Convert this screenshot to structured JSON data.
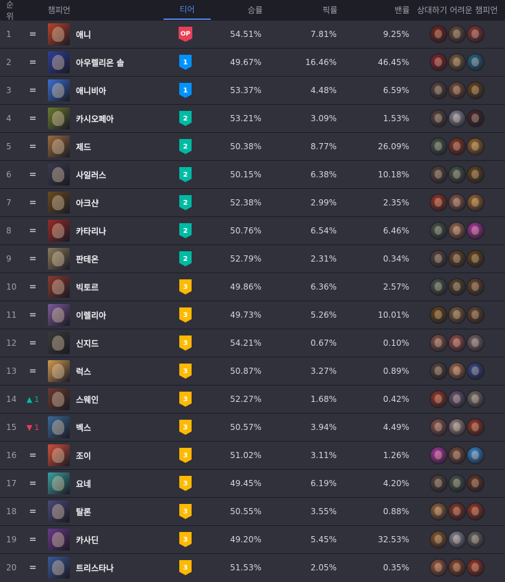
{
  "colors": {
    "op": "#e84057",
    "tier1": "#0093ff",
    "tier2": "#00bba3",
    "tier3": "#ffb900",
    "up": "#00bba3",
    "down": "#e84057",
    "active_tab": "#5383e8"
  },
  "header": {
    "rank": "순위",
    "champion": "챔피언",
    "tier": "티어",
    "winrate": "승률",
    "pickrate": "픽률",
    "banrate": "밴률",
    "counters": "상대하기 어려운 챔피언"
  },
  "rows": [
    {
      "rank": "1",
      "change": "=",
      "dir": "same",
      "name": "애니",
      "tier": "OP",
      "tierClass": "op",
      "win": "54.51%",
      "pick": "7.81%",
      "ban": "9.25%",
      "portrait": "#b8442a",
      "counters": [
        "#7a2a22",
        "#6a5140",
        "#8a3b3c"
      ]
    },
    {
      "rank": "2",
      "change": "=",
      "dir": "same",
      "name": "아우렐리온 솔",
      "tier": "1",
      "tierClass": "t1",
      "win": "49.67%",
      "pick": "16.46%",
      "ban": "46.45%",
      "portrait": "#2f3f9a",
      "counters": [
        "#8a2a30",
        "#7a6040",
        "#2a6a8a"
      ]
    },
    {
      "rank": "3",
      "change": "=",
      "dir": "same",
      "name": "애니비아",
      "tier": "1",
      "tierClass": "t1",
      "win": "53.37%",
      "pick": "4.48%",
      "ban": "6.59%",
      "portrait": "#3a6fd0",
      "counters": [
        "#5a4a44",
        "#7a5040",
        "#6a4a20"
      ]
    },
    {
      "rank": "4",
      "change": "=",
      "dir": "same",
      "name": "카시오페아",
      "tier": "2",
      "tierClass": "t2",
      "win": "53.21%",
      "pick": "3.09%",
      "ban": "1.53%",
      "portrait": "#6a7a30",
      "counters": [
        "#5a4a44",
        "#8a8a9a",
        "#4a2a30"
      ]
    },
    {
      "rank": "5",
      "change": "=",
      "dir": "same",
      "name": "제드",
      "tier": "2",
      "tierClass": "t2",
      "win": "50.38%",
      "pick": "8.77%",
      "ban": "26.09%",
      "portrait": "#9a6a40",
      "counters": [
        "#4a5a50",
        "#8a3a2a",
        "#9a6a30"
      ]
    },
    {
      "rank": "6",
      "change": "=",
      "dir": "same",
      "name": "사일러스",
      "tier": "2",
      "tierClass": "t2",
      "win": "50.15%",
      "pick": "6.38%",
      "ban": "10.18%",
      "portrait": "#3a3a50",
      "counters": [
        "#5a4a44",
        "#4a5a50",
        "#6a4a20"
      ]
    },
    {
      "rank": "7",
      "change": "=",
      "dir": "same",
      "name": "아크샨",
      "tier": "2",
      "tierClass": "t2",
      "win": "52.38%",
      "pick": "2.99%",
      "ban": "2.35%",
      "portrait": "#6a4a20",
      "counters": [
        "#9a3a2a",
        "#8a5a50",
        "#9a6a30"
      ]
    },
    {
      "rank": "8",
      "change": "=",
      "dir": "same",
      "name": "카타리나",
      "tier": "2",
      "tierClass": "t2",
      "win": "50.76%",
      "pick": "6.54%",
      "ban": "6.46%",
      "portrait": "#9a2a2a",
      "counters": [
        "#4a5a50",
        "#9a6a50",
        "#b03aa0"
      ]
    },
    {
      "rank": "9",
      "change": "=",
      "dir": "same",
      "name": "판테온",
      "tier": "2",
      "tierClass": "t2",
      "win": "52.79%",
      "pick": "2.31%",
      "ban": "0.34%",
      "portrait": "#8a7a5a",
      "counters": [
        "#5a4a44",
        "#6a4a30",
        "#6a4a20"
      ]
    },
    {
      "rank": "10",
      "change": "=",
      "dir": "same",
      "name": "빅토르",
      "tier": "3",
      "tierClass": "t3",
      "win": "49.86%",
      "pick": "6.36%",
      "ban": "2.57%",
      "portrait": "#8a3a30",
      "counters": [
        "#4a5a50",
        "#5a4a30",
        "#6a4a30"
      ]
    },
    {
      "rank": "11",
      "change": "=",
      "dir": "same",
      "name": "이렐리아",
      "tier": "3",
      "tierClass": "t3",
      "win": "49.73%",
      "pick": "5.26%",
      "ban": "10.01%",
      "portrait": "#7a5a9a",
      "counters": [
        "#6a4a20",
        "#7a6040",
        "#6a4a30"
      ]
    },
    {
      "rank": "12",
      "change": "=",
      "dir": "same",
      "name": "신지드",
      "tier": "3",
      "tierClass": "t3",
      "win": "54.21%",
      "pick": "0.67%",
      "ban": "0.10%",
      "portrait": "#3a3a3a",
      "counters": [
        "#8a5a50",
        "#9a5050",
        "#7a6a70"
      ]
    },
    {
      "rank": "13",
      "change": "=",
      "dir": "same",
      "name": "럭스",
      "tier": "3",
      "tierClass": "t3",
      "win": "50.87%",
      "pick": "3.27%",
      "ban": "0.89%",
      "portrait": "#d09a50",
      "counters": [
        "#5a4a44",
        "#a06a50",
        "#3a4a8a"
      ]
    },
    {
      "rank": "14",
      "change": "1",
      "dir": "up",
      "name": "스웨인",
      "tier": "3",
      "tierClass": "t3",
      "win": "52.27%",
      "pick": "1.68%",
      "ban": "0.42%",
      "portrait": "#6a3a30",
      "counters": [
        "#9a3a2a",
        "#6a5a7a",
        "#7a7070"
      ]
    },
    {
      "rank": "15",
      "change": "1",
      "dir": "down",
      "name": "벡스",
      "tier": "3",
      "tierClass": "t3",
      "win": "50.57%",
      "pick": "3.94%",
      "ban": "4.49%",
      "portrait": "#3a6a9a",
      "counters": [
        "#8a5a50",
        "#9a8a8a",
        "#9a3a2a"
      ]
    },
    {
      "rank": "16",
      "change": "=",
      "dir": "same",
      "name": "조이",
      "tier": "3",
      "tierClass": "t3",
      "win": "51.02%",
      "pick": "3.11%",
      "ban": "1.26%",
      "portrait": "#d0503a",
      "counters": [
        "#b03aa0",
        "#7a5040",
        "#3a8ad0"
      ]
    },
    {
      "rank": "17",
      "change": "=",
      "dir": "same",
      "name": "요네",
      "tier": "3",
      "tierClass": "t3",
      "win": "49.45%",
      "pick": "6.19%",
      "ban": "4.20%",
      "portrait": "#3aa0a0",
      "counters": [
        "#5a4a44",
        "#4a5a50",
        "#6a3a2a"
      ]
    },
    {
      "rank": "18",
      "change": "=",
      "dir": "same",
      "name": "탈론",
      "tier": "3",
      "tierClass": "t3",
      "win": "50.55%",
      "pick": "3.55%",
      "ban": "0.88%",
      "portrait": "#4a4a7a",
      "counters": [
        "#9a6a40",
        "#8a3a2a",
        "#9a3a2a"
      ]
    },
    {
      "rank": "19",
      "change": "=",
      "dir": "same",
      "name": "카사딘",
      "tier": "3",
      "tierClass": "t3",
      "win": "49.20%",
      "pick": "5.45%",
      "ban": "32.53%",
      "portrait": "#6a3a8a",
      "counters": [
        "#8a5a30",
        "#8a8a9a",
        "#6a6a6a"
      ]
    },
    {
      "rank": "20",
      "change": "=",
      "dir": "same",
      "name": "트리스타나",
      "tier": "3",
      "tierClass": "t3",
      "win": "51.53%",
      "pick": "2.05%",
      "ban": "0.35%",
      "portrait": "#3a5a9a",
      "counters": [
        "#9a5a40",
        "#8a4a30",
        "#9a3a2a"
      ]
    }
  ]
}
